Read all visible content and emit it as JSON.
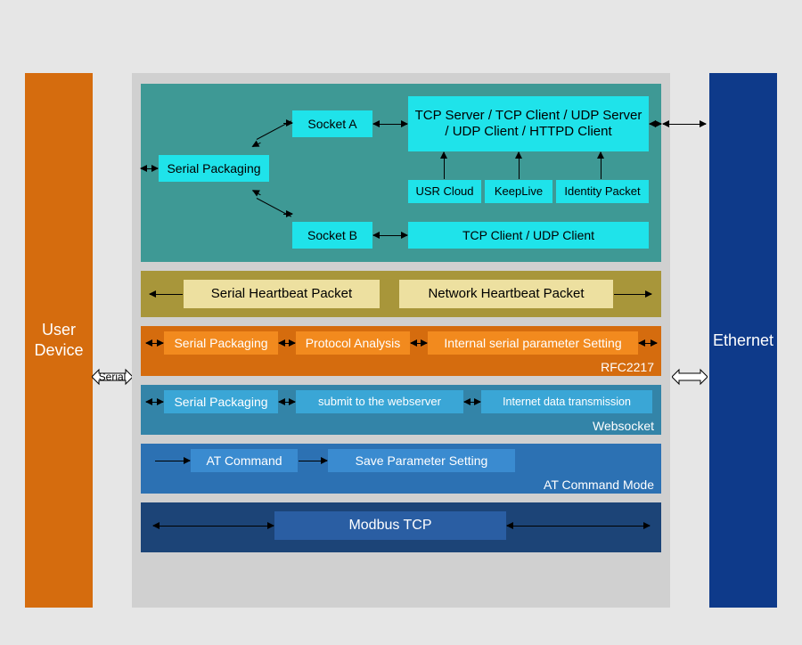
{
  "left_label": "User\nDevice",
  "right_label": "Ethernet",
  "serial_label": "Serial",
  "group1": {
    "socket_a": "Socket A",
    "socket_b": "Socket B",
    "serial_packaging": "Serial Packaging",
    "tcp_modes": "TCP Server / TCP Client / UDP Server / UDP Client / HTTPD Client",
    "usr_cloud": "USR Cloud",
    "keeplive": "KeepLive",
    "identity": "Identity Packet",
    "tcp_udp_client": "TCP Client / UDP Client"
  },
  "group2": {
    "serial_hb": "Serial Heartbeat Packet",
    "network_hb": "Network Heartbeat Packet"
  },
  "group3": {
    "serial_packaging": "Serial Packaging",
    "protocol": "Protocol Analysis",
    "internal": "Internal serial parameter Setting",
    "label": "RFC2217"
  },
  "group4": {
    "serial_packaging": "Serial Packaging",
    "submit": "submit to the webserver",
    "internet": "Internet data  transmission",
    "label": "Websocket"
  },
  "group5": {
    "at_cmd": "AT Command",
    "save": "Save Parameter Setting",
    "label": "AT Command Mode"
  },
  "group6": {
    "modbus": "Modbus TCP"
  }
}
